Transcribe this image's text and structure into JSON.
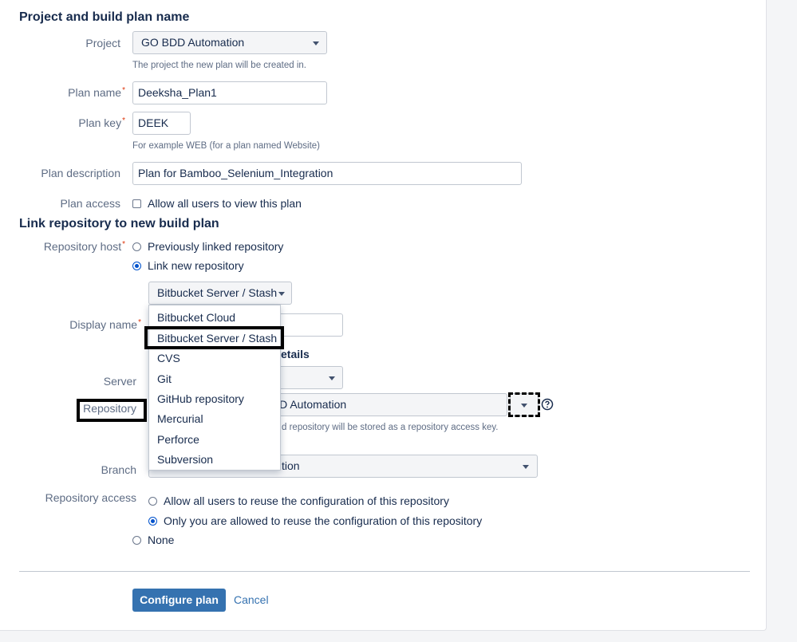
{
  "section1": {
    "heading": "Project and build plan name"
  },
  "project": {
    "label": "Project",
    "value": "GO BDD Automation",
    "description": "The project the new plan will be created in."
  },
  "plan_name": {
    "label": "Plan name",
    "value": "Deeksha_Plan1"
  },
  "plan_key": {
    "label": "Plan key",
    "value": "DEEK",
    "description": "For example WEB (for a plan named Website)"
  },
  "plan_description": {
    "label": "Plan description",
    "value": "Plan for Bamboo_Selenium_Integration"
  },
  "plan_access": {
    "label": "Plan access",
    "checkbox_label": "Allow all users to view this plan",
    "checked": false
  },
  "section2": {
    "heading": "Link repository to new build plan"
  },
  "repository_host": {
    "label": "Repository host",
    "options": [
      {
        "label": "Previously linked repository",
        "selected": false
      },
      {
        "label": "Link new repository",
        "selected": true
      }
    ],
    "type_select_value": "Bitbucket Server / Stash",
    "type_options": [
      "Bitbucket Cloud",
      "Bitbucket Server / Stash",
      "CVS",
      "Git",
      "GitHub repository",
      "Mercurial",
      "Perforce",
      "Subversion"
    ],
    "highlighted_option": "Bitbucket Server / Stash"
  },
  "display_name": {
    "label": "Display name"
  },
  "server_details": {
    "heading_partial": "etails"
  },
  "server": {
    "label": "Server"
  },
  "repository": {
    "label": "Repository",
    "value_partial": "DD Automation",
    "description_partial": "d repository will be stored as a repository access key."
  },
  "branch": {
    "label": "Branch",
    "value_partial": "tion"
  },
  "repository_access": {
    "label": "Repository access",
    "options": [
      {
        "label": "Allow all users to reuse the configuration of this repository",
        "selected": false
      },
      {
        "label": "Only you are allowed to reuse the configuration of this repository",
        "selected": true
      },
      {
        "label": "None",
        "selected": false
      }
    ]
  },
  "actions": {
    "configure_label": "Configure plan",
    "cancel_label": "Cancel"
  },
  "colors": {
    "primary": "#3572b0",
    "required": "#de350b",
    "highlight_box": "#000000"
  },
  "icons": {
    "help": "help-circle-icon",
    "caret": "chevron-down-icon"
  }
}
